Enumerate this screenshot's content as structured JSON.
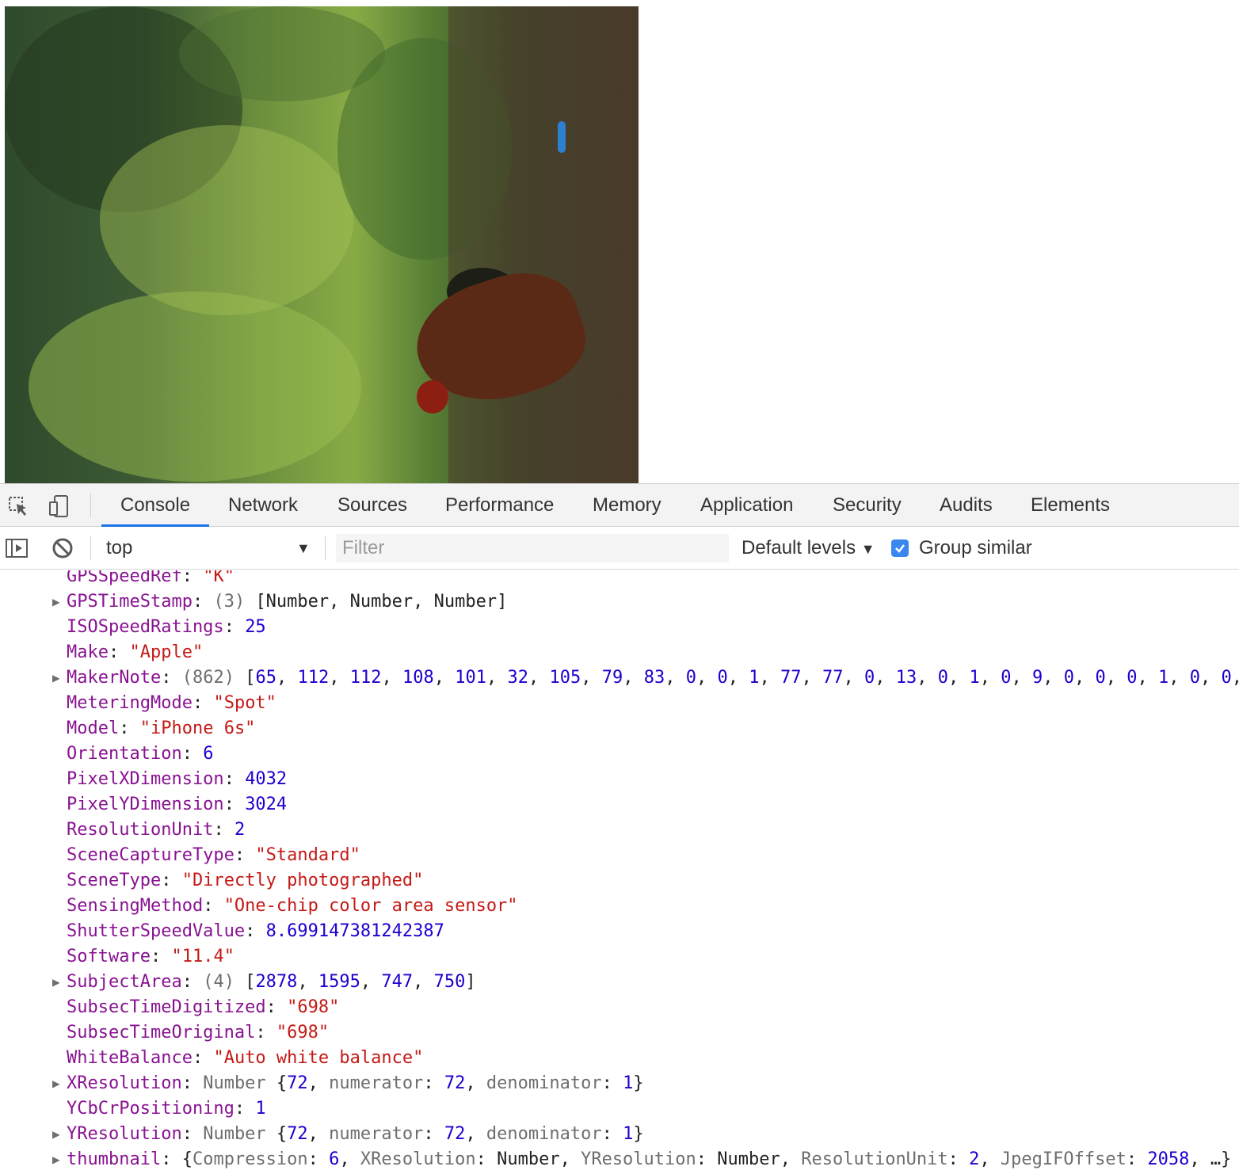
{
  "devtools": {
    "tabs": [
      "Console",
      "Network",
      "Sources",
      "Performance",
      "Memory",
      "Application",
      "Security",
      "Audits",
      "Elements"
    ],
    "active_tab": "Console",
    "accent_color": "#1a73e8"
  },
  "toolbar": {
    "context_value": "top",
    "filter_placeholder": "Filter",
    "levels_label": "Default levels",
    "group_similar_label": "Group similar",
    "group_similar_checked": true
  },
  "console": {
    "rows": [
      {
        "expandable": false,
        "key": "GPSSpeedRef",
        "parts": [
          {
            "t": "\"K\"",
            "c": "s"
          }
        ]
      },
      {
        "expandable": true,
        "key": "GPSTimeStamp",
        "parts": [
          {
            "t": "(3) ",
            "c": "g"
          },
          {
            "t": "[Number, Number, Number]",
            "c": "p"
          }
        ]
      },
      {
        "expandable": false,
        "key": "ISOSpeedRatings",
        "parts": [
          {
            "t": "25",
            "c": "n"
          }
        ]
      },
      {
        "expandable": false,
        "key": "Make",
        "parts": [
          {
            "t": "\"Apple\"",
            "c": "s"
          }
        ]
      },
      {
        "expandable": true,
        "key": "MakerNote",
        "parts": [
          {
            "t": "(862) ",
            "c": "g"
          },
          {
            "t": "[",
            "c": "p"
          },
          {
            "t": "65",
            "c": "n"
          },
          {
            "t": ", ",
            "c": "p"
          },
          {
            "t": "112",
            "c": "n"
          },
          {
            "t": ", ",
            "c": "p"
          },
          {
            "t": "112",
            "c": "n"
          },
          {
            "t": ", ",
            "c": "p"
          },
          {
            "t": "108",
            "c": "n"
          },
          {
            "t": ", ",
            "c": "p"
          },
          {
            "t": "101",
            "c": "n"
          },
          {
            "t": ", ",
            "c": "p"
          },
          {
            "t": "32",
            "c": "n"
          },
          {
            "t": ", ",
            "c": "p"
          },
          {
            "t": "105",
            "c": "n"
          },
          {
            "t": ", ",
            "c": "p"
          },
          {
            "t": "79",
            "c": "n"
          },
          {
            "t": ", ",
            "c": "p"
          },
          {
            "t": "83",
            "c": "n"
          },
          {
            "t": ", ",
            "c": "p"
          },
          {
            "t": "0",
            "c": "n"
          },
          {
            "t": ", ",
            "c": "p"
          },
          {
            "t": "0",
            "c": "n"
          },
          {
            "t": ", ",
            "c": "p"
          },
          {
            "t": "1",
            "c": "n"
          },
          {
            "t": ", ",
            "c": "p"
          },
          {
            "t": "77",
            "c": "n"
          },
          {
            "t": ", ",
            "c": "p"
          },
          {
            "t": "77",
            "c": "n"
          },
          {
            "t": ", ",
            "c": "p"
          },
          {
            "t": "0",
            "c": "n"
          },
          {
            "t": ", ",
            "c": "p"
          },
          {
            "t": "13",
            "c": "n"
          },
          {
            "t": ", ",
            "c": "p"
          },
          {
            "t": "0",
            "c": "n"
          },
          {
            "t": ", ",
            "c": "p"
          },
          {
            "t": "1",
            "c": "n"
          },
          {
            "t": ", ",
            "c": "p"
          },
          {
            "t": "0",
            "c": "n"
          },
          {
            "t": ", ",
            "c": "p"
          },
          {
            "t": "9",
            "c": "n"
          },
          {
            "t": ", ",
            "c": "p"
          },
          {
            "t": "0",
            "c": "n"
          },
          {
            "t": ", ",
            "c": "p"
          },
          {
            "t": "0",
            "c": "n"
          },
          {
            "t": ", ",
            "c": "p"
          },
          {
            "t": "0",
            "c": "n"
          },
          {
            "t": ", ",
            "c": "p"
          },
          {
            "t": "1",
            "c": "n"
          },
          {
            "t": ", ",
            "c": "p"
          },
          {
            "t": "0",
            "c": "n"
          },
          {
            "t": ", ",
            "c": "p"
          },
          {
            "t": "0",
            "c": "n"
          },
          {
            "t": ",",
            "c": "p"
          }
        ]
      },
      {
        "expandable": false,
        "key": "MeteringMode",
        "parts": [
          {
            "t": "\"Spot\"",
            "c": "s"
          }
        ]
      },
      {
        "expandable": false,
        "key": "Model",
        "parts": [
          {
            "t": "\"iPhone 6s\"",
            "c": "s"
          }
        ]
      },
      {
        "expandable": false,
        "key": "Orientation",
        "parts": [
          {
            "t": "6",
            "c": "n"
          }
        ]
      },
      {
        "expandable": false,
        "key": "PixelXDimension",
        "parts": [
          {
            "t": "4032",
            "c": "n"
          }
        ]
      },
      {
        "expandable": false,
        "key": "PixelYDimension",
        "parts": [
          {
            "t": "3024",
            "c": "n"
          }
        ]
      },
      {
        "expandable": false,
        "key": "ResolutionUnit",
        "parts": [
          {
            "t": "2",
            "c": "n"
          }
        ]
      },
      {
        "expandable": false,
        "key": "SceneCaptureType",
        "parts": [
          {
            "t": "\"Standard\"",
            "c": "s"
          }
        ]
      },
      {
        "expandable": false,
        "key": "SceneType",
        "parts": [
          {
            "t": "\"Directly photographed\"",
            "c": "s"
          }
        ]
      },
      {
        "expandable": false,
        "key": "SensingMethod",
        "parts": [
          {
            "t": "\"One-chip color area sensor\"",
            "c": "s"
          }
        ]
      },
      {
        "expandable": false,
        "key": "ShutterSpeedValue",
        "parts": [
          {
            "t": "8.699147381242387",
            "c": "n"
          }
        ]
      },
      {
        "expandable": false,
        "key": "Software",
        "parts": [
          {
            "t": "\"11.4\"",
            "c": "s"
          }
        ]
      },
      {
        "expandable": true,
        "key": "SubjectArea",
        "parts": [
          {
            "t": "(4) ",
            "c": "g"
          },
          {
            "t": "[",
            "c": "p"
          },
          {
            "t": "2878",
            "c": "n"
          },
          {
            "t": ", ",
            "c": "p"
          },
          {
            "t": "1595",
            "c": "n"
          },
          {
            "t": ", ",
            "c": "p"
          },
          {
            "t": "747",
            "c": "n"
          },
          {
            "t": ", ",
            "c": "p"
          },
          {
            "t": "750",
            "c": "n"
          },
          {
            "t": "]",
            "c": "p"
          }
        ]
      },
      {
        "expandable": false,
        "key": "SubsecTimeDigitized",
        "parts": [
          {
            "t": "\"698\"",
            "c": "s"
          }
        ]
      },
      {
        "expandable": false,
        "key": "SubsecTimeOriginal",
        "parts": [
          {
            "t": "\"698\"",
            "c": "s"
          }
        ]
      },
      {
        "expandable": false,
        "key": "WhiteBalance",
        "parts": [
          {
            "t": "\"Auto white balance\"",
            "c": "s"
          }
        ]
      },
      {
        "expandable": true,
        "key": "XResolution",
        "parts": [
          {
            "t": "Number ",
            "c": "g"
          },
          {
            "t": "{",
            "c": "p"
          },
          {
            "t": "72",
            "c": "n"
          },
          {
            "t": ", ",
            "c": "p"
          },
          {
            "t": "numerator",
            "c": "g"
          },
          {
            "t": ": ",
            "c": "p"
          },
          {
            "t": "72",
            "c": "n"
          },
          {
            "t": ", ",
            "c": "p"
          },
          {
            "t": "denominator",
            "c": "g"
          },
          {
            "t": ": ",
            "c": "p"
          },
          {
            "t": "1",
            "c": "n"
          },
          {
            "t": "}",
            "c": "p"
          }
        ]
      },
      {
        "expandable": false,
        "key": "YCbCrPositioning",
        "parts": [
          {
            "t": "1",
            "c": "n"
          }
        ]
      },
      {
        "expandable": true,
        "key": "YResolution",
        "parts": [
          {
            "t": "Number ",
            "c": "g"
          },
          {
            "t": "{",
            "c": "p"
          },
          {
            "t": "72",
            "c": "n"
          },
          {
            "t": ", ",
            "c": "p"
          },
          {
            "t": "numerator",
            "c": "g"
          },
          {
            "t": ": ",
            "c": "p"
          },
          {
            "t": "72",
            "c": "n"
          },
          {
            "t": ", ",
            "c": "p"
          },
          {
            "t": "denominator",
            "c": "g"
          },
          {
            "t": ": ",
            "c": "p"
          },
          {
            "t": "1",
            "c": "n"
          },
          {
            "t": "}",
            "c": "p"
          }
        ]
      },
      {
        "expandable": true,
        "key": "thumbnail",
        "parts": [
          {
            "t": "{",
            "c": "p"
          },
          {
            "t": "Compression",
            "c": "g"
          },
          {
            "t": ": ",
            "c": "p"
          },
          {
            "t": "6",
            "c": "n"
          },
          {
            "t": ", ",
            "c": "p"
          },
          {
            "t": "XResolution",
            "c": "g"
          },
          {
            "t": ": Number, ",
            "c": "p"
          },
          {
            "t": "YResolution",
            "c": "g"
          },
          {
            "t": ": Number, ",
            "c": "p"
          },
          {
            "t": "ResolutionUnit",
            "c": "g"
          },
          {
            "t": ": ",
            "c": "p"
          },
          {
            "t": "2",
            "c": "n"
          },
          {
            "t": ", ",
            "c": "p"
          },
          {
            "t": "JpegIFOffset",
            "c": "g"
          },
          {
            "t": ": ",
            "c": "p"
          },
          {
            "t": "2058",
            "c": "n"
          },
          {
            "t": ", …}",
            "c": "p"
          }
        ]
      }
    ]
  }
}
